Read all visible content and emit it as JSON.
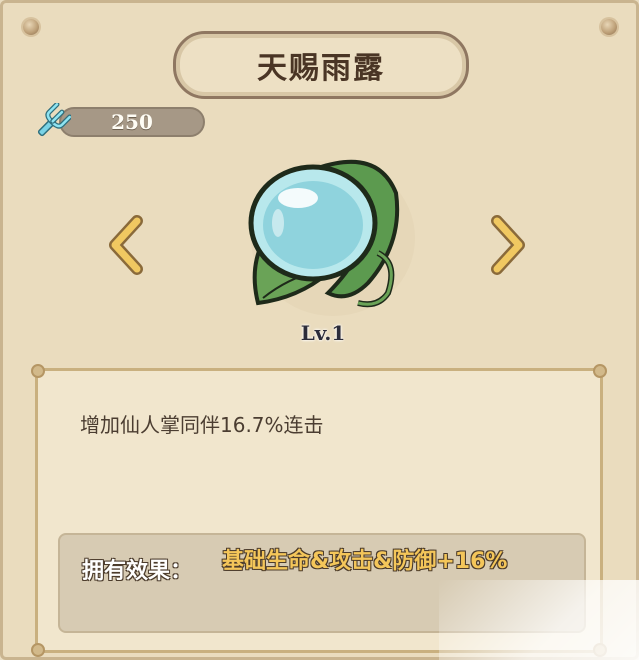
{
  "title": "天赐雨露",
  "currency": {
    "icon": "fork-icon",
    "value": "250"
  },
  "navigation": {
    "prev": "chevron-left-icon",
    "next": "chevron-right-icon"
  },
  "item": {
    "icon": "dew-gem-leaf-icon",
    "level": "Lv.1"
  },
  "description": "增加仙人掌同伴16.7%连击",
  "effect": {
    "label": "拥有效果：",
    "value": "基础生命&攻击&防御+16%"
  },
  "colors": {
    "background": "#eadcbe",
    "title_border": "#8f7761",
    "effect_value": "#f4c65a",
    "arrow": "#e7bc4e"
  }
}
